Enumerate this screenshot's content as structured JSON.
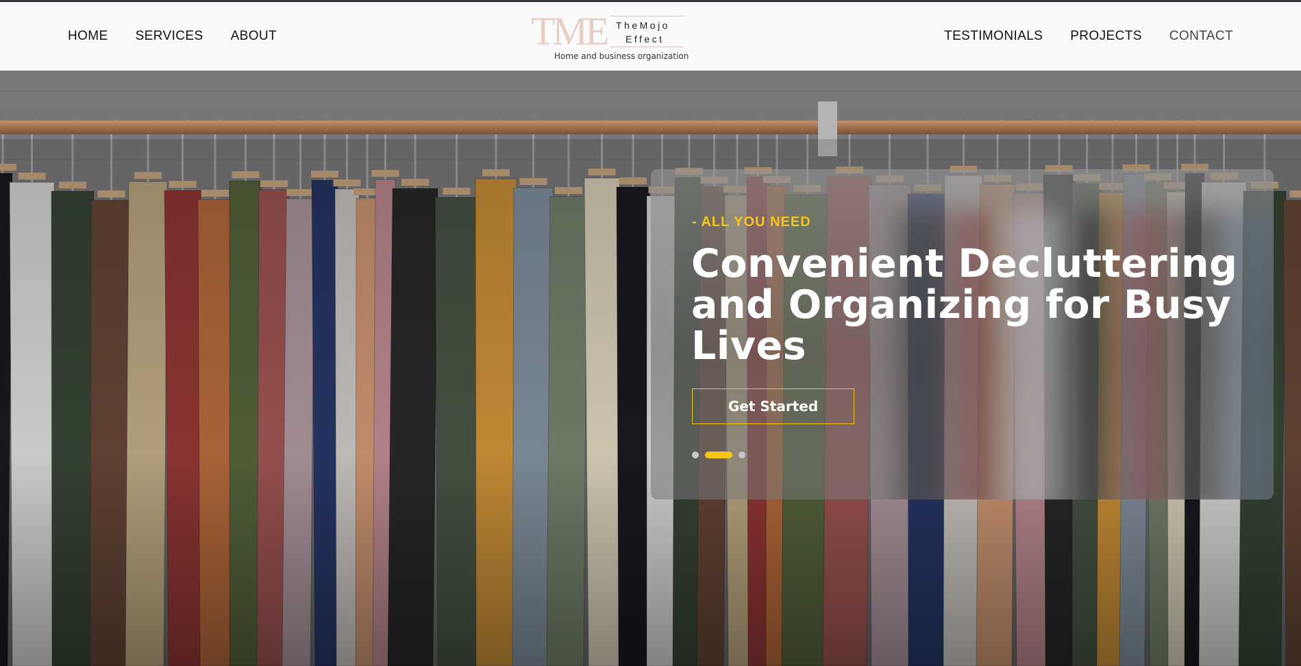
{
  "nav": {
    "left": [
      {
        "label": "HOME"
      },
      {
        "label": "SERVICES"
      },
      {
        "label": "ABOUT"
      }
    ],
    "right": [
      {
        "label": "TESTIMONIALS"
      },
      {
        "label": "PROJECTS"
      },
      {
        "label": "CONTACT"
      }
    ]
  },
  "logo": {
    "mark": "TME",
    "line1": "TheMojo",
    "line2": "Effect",
    "tagline": "Home and business organization"
  },
  "hero": {
    "eyebrow": "- ALL YOU NEED",
    "headline": "Convenient Decluttering and Organizing for Busy Lives",
    "cta_label": "Get Started",
    "slides": {
      "count": 3,
      "active_index": 1
    },
    "accent_color": "#f5c518",
    "background_image": "clothing rack with hanging garments"
  }
}
